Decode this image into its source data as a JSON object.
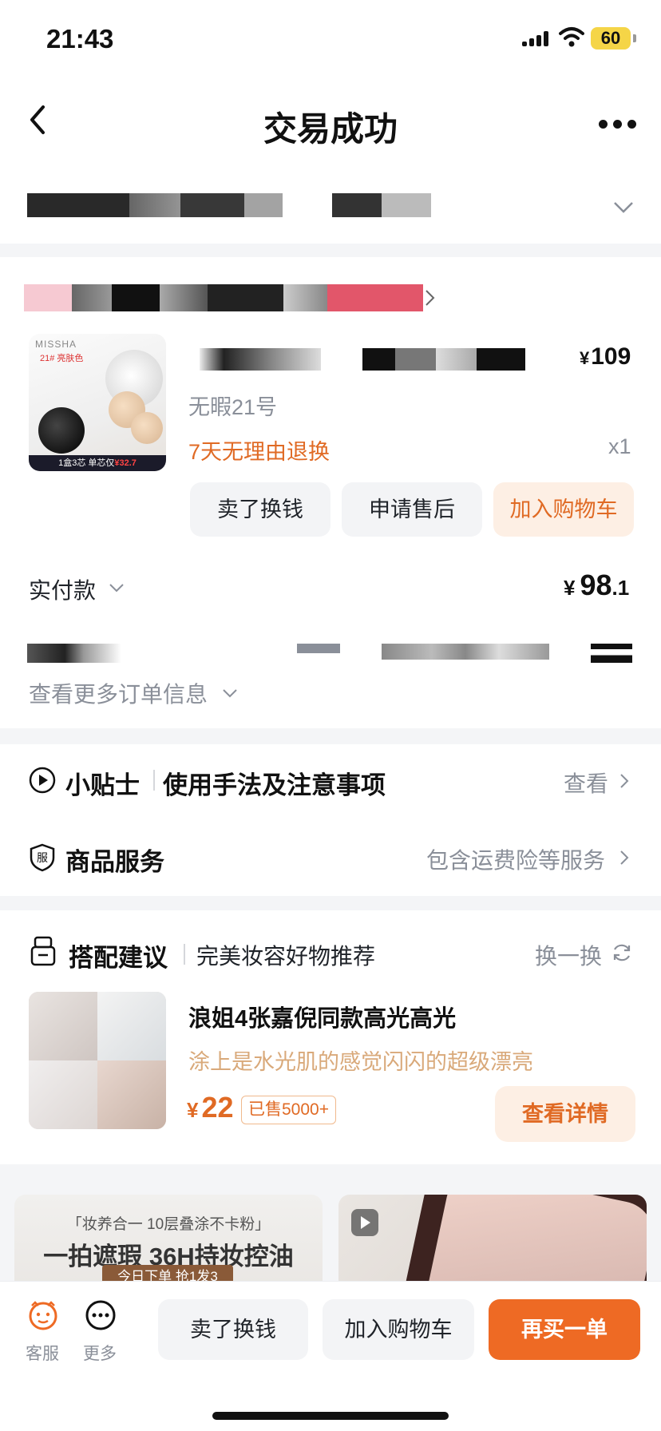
{
  "status": {
    "time": "21:43",
    "battery": "60"
  },
  "nav": {
    "title": "交易成功"
  },
  "product": {
    "price": "109",
    "currency": "¥",
    "spec": "无暇21号",
    "return_policy": "7天无理由退换",
    "qty": "x1",
    "thumb": {
      "brand": "MISSHA",
      "shade": "21# 亮肤色",
      "strip": "1盒3芯  单芯仅",
      "strip_price": "¥32.7"
    },
    "actions": {
      "sell": "卖了换钱",
      "after_sale": "申请售后",
      "add_cart": "加入购物车"
    }
  },
  "payment": {
    "label": "实付款",
    "amount_int": "98",
    "amount_dec": ".1",
    "currency": "¥"
  },
  "order": {
    "more_info": "查看更多订单信息"
  },
  "tips": {
    "title": "小贴士",
    "subtitle": "使用手法及注意事项",
    "action": "查看"
  },
  "service": {
    "title": "商品服务",
    "detail": "包含运费险等服务"
  },
  "suggestion": {
    "title": "搭配建议",
    "subtitle": "完美妆容好物推荐",
    "refresh": "换一换",
    "item": {
      "name": "浪姐4张嘉倪同款高光高光",
      "desc": "涂上是水光肌的感觉闪闪的超级漂亮",
      "price": "22",
      "currency": "¥",
      "sold": "已售5000+",
      "view": "查看详情"
    }
  },
  "feed": {
    "left": {
      "line1": "「妆养合一 10层叠涂不卡粉」",
      "line2": "一拍遮瑕 36H持妆控油",
      "line3": "今日下单 抢1发3"
    }
  },
  "bottom": {
    "service": "客服",
    "more": "更多",
    "sell": "卖了换钱",
    "add_cart": "加入购物车",
    "rebuy": "再买一单"
  },
  "colors": {
    "accent": "#ee6a24",
    "accent_soft": "#fdefe4",
    "muted": "#8a8f99"
  }
}
